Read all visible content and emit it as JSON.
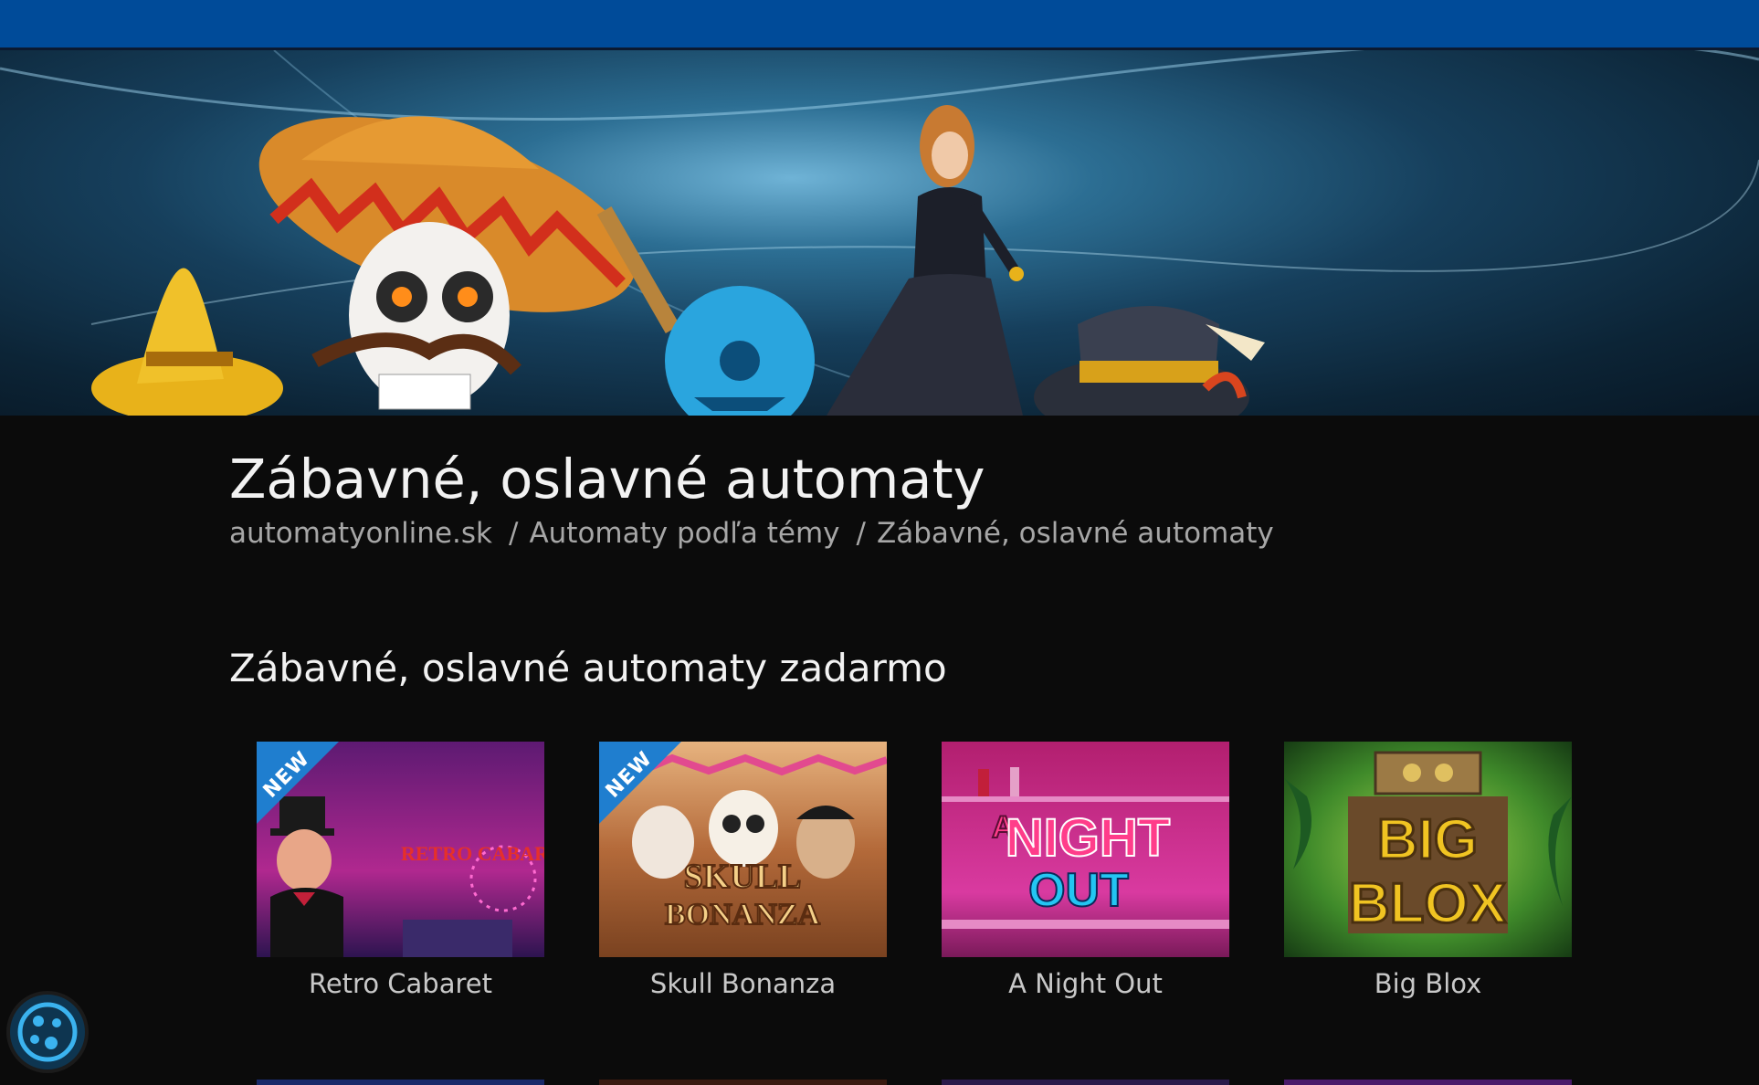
{
  "hero": {
    "image_name": "hero-banner-mexican-characters"
  },
  "page_title": "Zábavné, oslavné automaty",
  "breadcrumb": {
    "items": [
      "automatyonline.sk",
      "Automaty podľa témy",
      "Zábavné, oslavné automaty"
    ],
    "separator": "/"
  },
  "section_title": "Zábavné, oslavné automaty zadarmo",
  "games": [
    {
      "name": "Retro Cabaret",
      "logo_text": "RETRO CABARET",
      "badge": "NEW"
    },
    {
      "name": "Skull Bonanza",
      "logo_text_1": "SKULL",
      "logo_text_2": "BONANZA",
      "badge": "NEW"
    },
    {
      "name": "A Night Out",
      "logo_text_1": "A",
      "logo_text_2": "NIGHT",
      "logo_text_3": "OUT"
    },
    {
      "name": "Big Blox",
      "logo_text_1": "BIG",
      "logo_text_2": "BLOX"
    }
  ],
  "colors": {
    "top_bar": "#004b99",
    "badge": "#1f7ecf",
    "background": "#0b0b0b"
  },
  "cookie_button": {
    "icon": "cookie-icon"
  }
}
